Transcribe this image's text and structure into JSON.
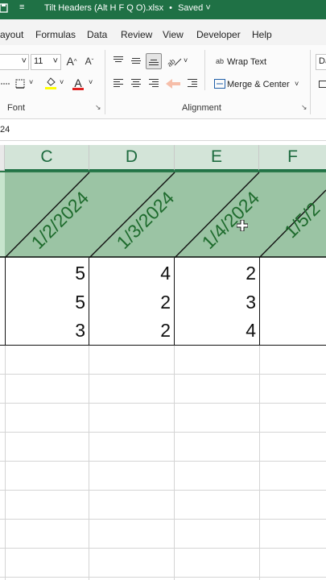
{
  "title_bar": {
    "filename": "Tilt Headers (Alt H F Q O).xlsx",
    "separator": "•",
    "status": "Saved",
    "status_chevron": "˅",
    "qat_icon": "≡",
    "app_icon": "save-icon"
  },
  "tabs": [
    {
      "label": "ayout"
    },
    {
      "label": "Formulas"
    },
    {
      "label": "Data"
    },
    {
      "label": "Review"
    },
    {
      "label": "View"
    },
    {
      "label": "Developer"
    },
    {
      "label": "Help"
    }
  ],
  "ribbon": {
    "font_size": "11",
    "grow_font": "A",
    "shrink_font": "A",
    "fill_icon": "◇",
    "font_color_letter": "A",
    "wrap_text": "Wrap Text",
    "merge_center": "Merge & Center",
    "number_format_partial": "Dat",
    "font_group": "Font",
    "alignment_group": "Alignment",
    "dialog_launcher": "↘",
    "wrap_icon": "ab",
    "caret": "˅"
  },
  "formula_bar": {
    "partial_text": "24"
  },
  "columns": [
    {
      "letter": "C"
    },
    {
      "letter": "D"
    },
    {
      "letter": "E"
    },
    {
      "letter": "F"
    }
  ],
  "header_row": {
    "left_partial": "/4",
    "dates": [
      "1/2/2024",
      "1/3/2024",
      "1/4/2024",
      "1/5/2"
    ]
  },
  "rows": [
    {
      "values": [
        "5",
        "4",
        "2"
      ]
    },
    {
      "values": [
        "5",
        "2",
        "3"
      ]
    },
    {
      "values": [
        "3",
        "2",
        "4"
      ]
    }
  ],
  "colors": {
    "excel_green": "#1f7145",
    "header_fill": "#9bc4a4",
    "date_text": "#1e6b2d"
  }
}
